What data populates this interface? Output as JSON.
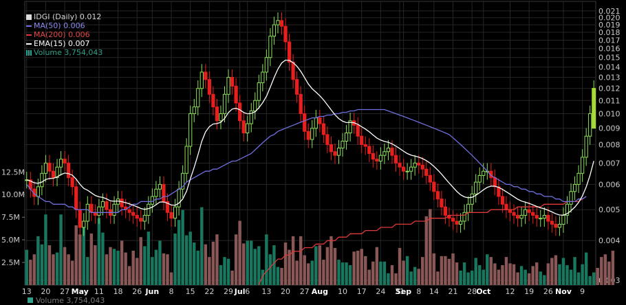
{
  "chart_data": {
    "type": "candlestick",
    "title": "IDGI (Daily) 0.012",
    "price_scale": "log",
    "price_ylim": [
      0.0029,
      0.0225
    ],
    "price_ticks": [
      0.021,
      0.02,
      0.019,
      0.018,
      0.017,
      0.016,
      0.015,
      0.014,
      0.013,
      0.012,
      0.011,
      0.01,
      0.009,
      0.008,
      0.007,
      0.006,
      0.005,
      0.004,
      0.003
    ],
    "price_tick_labels": [
      "0.021",
      "0.020",
      "0.019",
      "0.018",
      "0.017",
      "0.016",
      "0.015",
      "0.014",
      "0.013",
      "0.012",
      "0.011",
      "0.010",
      "0.009",
      "0.008",
      "0.007",
      "0.006",
      "0.005",
      "0.004",
      "0.003"
    ],
    "volume_ticks": [
      2.5,
      5.0,
      7.5,
      10.0,
      12.5
    ],
    "volume_tick_labels": [
      "2.5M",
      "5.0M",
      "7.5M",
      "10.0M",
      "12.5M"
    ],
    "volume_ylim": [
      0,
      17
    ],
    "x_tick_labels": [
      {
        "label": "13",
        "i": 0,
        "bold": false
      },
      {
        "label": "20",
        "i": 5,
        "bold": false
      },
      {
        "label": "27",
        "i": 10,
        "bold": false
      },
      {
        "label": "May",
        "i": 14,
        "bold": true
      },
      {
        "label": "11",
        "i": 19,
        "bold": false
      },
      {
        "label": "18",
        "i": 24,
        "bold": false
      },
      {
        "label": "26",
        "i": 29,
        "bold": false
      },
      {
        "label": "Jun",
        "i": 33,
        "bold": true
      },
      {
        "label": "8",
        "i": 38,
        "bold": false
      },
      {
        "label": "15",
        "i": 43,
        "bold": false
      },
      {
        "label": "22",
        "i": 48,
        "bold": false
      },
      {
        "label": "29",
        "i": 53,
        "bold": false
      },
      {
        "label": "Jul",
        "i": 56,
        "bold": true
      },
      {
        "label": "6",
        "i": 58,
        "bold": false
      },
      {
        "label": "13",
        "i": 63,
        "bold": false
      },
      {
        "label": "20",
        "i": 68,
        "bold": false
      },
      {
        "label": "27",
        "i": 73,
        "bold": false
      },
      {
        "label": "Aug",
        "i": 77,
        "bold": true
      },
      {
        "label": "10",
        "i": 83,
        "bold": false
      },
      {
        "label": "17",
        "i": 88,
        "bold": false
      },
      {
        "label": "24",
        "i": 93,
        "bold": false
      },
      {
        "label": "31",
        "i": 98,
        "bold": false
      },
      {
        "label": "Sep",
        "i": 99,
        "bold": true
      },
      {
        "label": "8",
        "i": 103,
        "bold": false
      },
      {
        "label": "14",
        "i": 107,
        "bold": false
      },
      {
        "label": "21",
        "i": 112,
        "bold": false
      },
      {
        "label": "28",
        "i": 117,
        "bold": false
      },
      {
        "label": "Oct",
        "i": 120,
        "bold": true
      },
      {
        "label": "12",
        "i": 127,
        "bold": false
      },
      {
        "label": "19",
        "i": 132,
        "bold": false
      },
      {
        "label": "26",
        "i": 137,
        "bold": false
      },
      {
        "label": "Nov",
        "i": 141,
        "bold": true
      },
      {
        "label": "9",
        "i": 146,
        "bold": false
      }
    ],
    "series": [
      {
        "name": "IDGI (Daily) 0.012",
        "color": "#dddddd"
      },
      {
        "name": "MA(50) 0.006",
        "color": "#6f6fe0"
      },
      {
        "name": "MA(200) 0.006",
        "color": "#e03a3a"
      },
      {
        "name": "EMA(15) 0.007",
        "color": "#ffffff"
      },
      {
        "name": "Volume 3,754,043",
        "color": "#2fa08a"
      }
    ],
    "close": [
      0.0062,
      0.0058,
      0.0055,
      0.0059,
      0.0065,
      0.007,
      0.0066,
      0.0063,
      0.0068,
      0.0072,
      0.007,
      0.0063,
      0.0059,
      0.005,
      0.0044,
      0.0046,
      0.0052,
      0.0049,
      0.0048,
      0.0051,
      0.0053,
      0.005,
      0.0048,
      0.0052,
      0.0054,
      0.0051,
      0.005,
      0.0049,
      0.0048,
      0.0047,
      0.0046,
      0.0048,
      0.0052,
      0.0055,
      0.0058,
      0.006,
      0.0053,
      0.0049,
      0.0047,
      0.0051,
      0.0058,
      0.0065,
      0.0079,
      0.01,
      0.0105,
      0.012,
      0.0135,
      0.0128,
      0.0115,
      0.0105,
      0.0095,
      0.01,
      0.0115,
      0.013,
      0.0122,
      0.0108,
      0.0095,
      0.0087,
      0.0093,
      0.0102,
      0.011,
      0.0125,
      0.0135,
      0.015,
      0.0175,
      0.019,
      0.0196,
      0.0188,
      0.0168,
      0.0145,
      0.0128,
      0.0115,
      0.01,
      0.0088,
      0.0083,
      0.009,
      0.0097,
      0.0093,
      0.0086,
      0.008,
      0.0076,
      0.0074,
      0.0078,
      0.0082,
      0.0087,
      0.0095,
      0.0092,
      0.0085,
      0.008,
      0.0079,
      0.0075,
      0.0072,
      0.0071,
      0.0074,
      0.0076,
      0.0078,
      0.0074,
      0.007,
      0.0068,
      0.0066,
      0.0066,
      0.0068,
      0.007,
      0.0069,
      0.0067,
      0.0064,
      0.0061,
      0.0057,
      0.0054,
      0.0051,
      0.0048,
      0.0047,
      0.0046,
      0.0045,
      0.0046,
      0.0049,
      0.0052,
      0.0056,
      0.0061,
      0.0064,
      0.0066,
      0.0066,
      0.0063,
      0.0059,
      0.0055,
      0.0052,
      0.005,
      0.0049,
      0.0048,
      0.0047,
      0.0048,
      0.005,
      0.0049,
      0.0048,
      0.0047,
      0.0047,
      0.0048,
      0.0046,
      0.0045,
      0.0044,
      0.0045,
      0.0048,
      0.0052,
      0.0057,
      0.006,
      0.0065,
      0.0073,
      0.0085,
      0.01,
      0.012
    ],
    "ma50": [
      0.006,
      0.0058,
      0.0056,
      0.0055,
      0.0054,
      0.0053,
      0.0053,
      0.0052,
      0.0052,
      0.0052,
      0.0052,
      0.0051,
      0.0051,
      0.005,
      0.005,
      0.005,
      0.005,
      0.0049,
      0.0049,
      0.0049,
      0.0049,
      0.0049,
      0.0049,
      0.0049,
      0.0049,
      0.005,
      0.005,
      0.0051,
      0.0052,
      0.0052,
      0.0053,
      0.0053,
      0.0053,
      0.0053,
      0.0054,
      0.0054,
      0.0055,
      0.0055,
      0.0056,
      0.0057,
      0.0058,
      0.0059,
      0.0061,
      0.0062,
      0.0063,
      0.0064,
      0.0065,
      0.0066,
      0.0066,
      0.0067,
      0.0067,
      0.0068,
      0.0069,
      0.007,
      0.0071,
      0.0071,
      0.0072,
      0.0073,
      0.0074,
      0.0075,
      0.0077,
      0.0079,
      0.0081,
      0.0083,
      0.0085,
      0.0086,
      0.0088,
      0.0089,
      0.009,
      0.0091,
      0.0092,
      0.0093,
      0.0094,
      0.0095,
      0.0096,
      0.0097,
      0.0097,
      0.0098,
      0.0098,
      0.0099,
      0.0099,
      0.01,
      0.01,
      0.0101,
      0.0101,
      0.0102,
      0.0102,
      0.0103,
      0.0103,
      0.0103,
      0.0103,
      0.0103,
      0.0103,
      0.0103,
      0.0103,
      0.0102,
      0.0101,
      0.01,
      0.0099,
      0.0098,
      0.0097,
      0.0096,
      0.0095,
      0.0094,
      0.0093,
      0.0092,
      0.0091,
      0.009,
      0.0089,
      0.0088,
      0.0087,
      0.0086,
      0.0084,
      0.0082,
      0.008,
      0.0078,
      0.0076,
      0.0074,
      0.0072,
      0.007,
      0.0068,
      0.0066,
      0.0064,
      0.0063,
      0.0062,
      0.0061,
      0.006,
      0.006,
      0.0059,
      0.0059,
      0.0058,
      0.0058,
      0.0057,
      0.0057,
      0.0056,
      0.0056,
      0.0055,
      0.0055,
      0.0055,
      0.0054,
      0.0054,
      0.0053,
      0.0053,
      0.0053,
      0.0053,
      0.0054,
      0.0054,
      0.0055
    ],
    "ma200": [
      null,
      null,
      null,
      null,
      null,
      null,
      null,
      null,
      null,
      null,
      null,
      null,
      null,
      null,
      null,
      null,
      null,
      null,
      null,
      null,
      null,
      null,
      null,
      null,
      null,
      null,
      null,
      null,
      null,
      null,
      null,
      null,
      null,
      null,
      null,
      null,
      null,
      null,
      null,
      null,
      null,
      null,
      null,
      null,
      null,
      null,
      null,
      null,
      null,
      null,
      null,
      null,
      null,
      null,
      null,
      null,
      null,
      null,
      null,
      null,
      null,
      0.0029,
      0.0031,
      0.0032,
      0.0033,
      0.0034,
      0.0035,
      0.0035,
      0.0036,
      0.0036,
      0.0037,
      0.0037,
      0.0037,
      0.0038,
      0.0038,
      0.0038,
      0.0039,
      0.0039,
      0.0039,
      0.004,
      0.004,
      0.004,
      0.0041,
      0.0041,
      0.0041,
      0.0042,
      0.0042,
      0.0042,
      0.0042,
      0.0043,
      0.0043,
      0.0043,
      0.0043,
      0.0044,
      0.0044,
      0.0044,
      0.0044,
      0.0045,
      0.0045,
      0.0045,
      0.0045,
      0.0045,
      0.0046,
      0.0046,
      0.0046,
      0.0046,
      0.0047,
      0.0047,
      0.0047,
      0.0047,
      0.0047,
      0.0048,
      0.0048,
      0.0048,
      0.0048,
      0.0048,
      0.0049,
      0.0049,
      0.0049,
      0.0049,
      0.0049,
      0.0049,
      0.005,
      0.005,
      0.005,
      0.005,
      0.005,
      0.005,
      0.005,
      0.0051,
      0.0051,
      0.0051,
      0.0051,
      0.0051,
      0.0051,
      0.0051,
      0.0052,
      0.0052,
      0.0052,
      0.0052,
      0.0052,
      0.0052,
      0.0053,
      0.0053,
      0.0053,
      0.0053,
      0.0054,
      0.0055
    ],
    "volume": [
      3.9,
      2.8,
      3.4,
      5.4,
      4.5,
      7.8,
      4.4,
      3.4,
      3.6,
      7.8,
      4.2,
      3.4,
      2.7,
      6.6,
      5.6,
      6.8,
      3.1,
      5.7,
      4.4,
      7.4,
      5.8,
      3.4,
      4.2,
      4.0,
      3.8,
      4.9,
      3.6,
      2.1,
      3.8,
      3.0,
      5.3,
      4.3,
      5.9,
      3.1,
      3.9,
      4.9,
      3.5,
      3.4,
      1.4,
      5.7,
      7.2,
      8.3,
      5.5,
      5.9,
      4.7,
      3.8,
      8.6,
      4.5,
      3.1,
      4.8,
      5.6,
      2.2,
      3.1,
      2.9,
      1.6,
      5.6,
      7.1,
      4.6,
      4.9,
      4.9,
      4.0,
      4.3,
      1.7,
      5.6,
      3.4,
      4.4,
      2.0,
      1.9,
      4.7,
      3.9,
      5.4,
      2.7,
      5.4,
      3.3,
      2.4,
      2.7,
      4.3,
      4.4,
      2.8,
      4.2,
      5.4,
      4.1,
      2.8,
      2.5,
      2.5,
      2.2,
      3.7,
      3.8,
      4.0,
      3.2,
      1.7,
      2.6,
      4.2,
      2.6,
      2.6,
      1.3,
      2.2,
      1.3,
      4.1,
      2.7,
      3.2,
      1.5,
      2.0,
      1.8,
      3.1,
      7.6,
      8.4,
      3.5,
      1.5,
      3.2,
      3.2,
      2.9,
      3.5,
      2.5,
      1.6,
      2.5,
      1.4,
      1.6,
      3.0,
      2.2,
      1.7,
      3.4,
      3.1,
      2.4,
      1.7,
      2.2,
      3.1,
      2.4,
      2.3,
      1.4,
      2.1,
      1.7,
      1.3,
      2.1,
      2.5,
      1.5,
      1.1,
      2.4,
      3.0,
      3.3,
      2.3,
      3.0,
      2.2,
      1.7,
      3.1,
      1.4,
      2.3,
      3.6,
      1.0,
      1.4,
      1.9,
      3.1,
      3.4,
      2.6,
      3.8
    ]
  },
  "scale_bars": {
    "top": 2,
    "bottom": 425,
    "legend_rows": [
      18,
      31,
      44,
      57,
      70
    ]
  },
  "colors": {
    "bg": "#000000",
    "grid": "#222222",
    "up": "#8fe35a",
    "down": "#e81f1f",
    "volume_up": "#17775f",
    "volume_down": "#8a5757"
  },
  "bottom_legend": "Volume 3,754,043"
}
